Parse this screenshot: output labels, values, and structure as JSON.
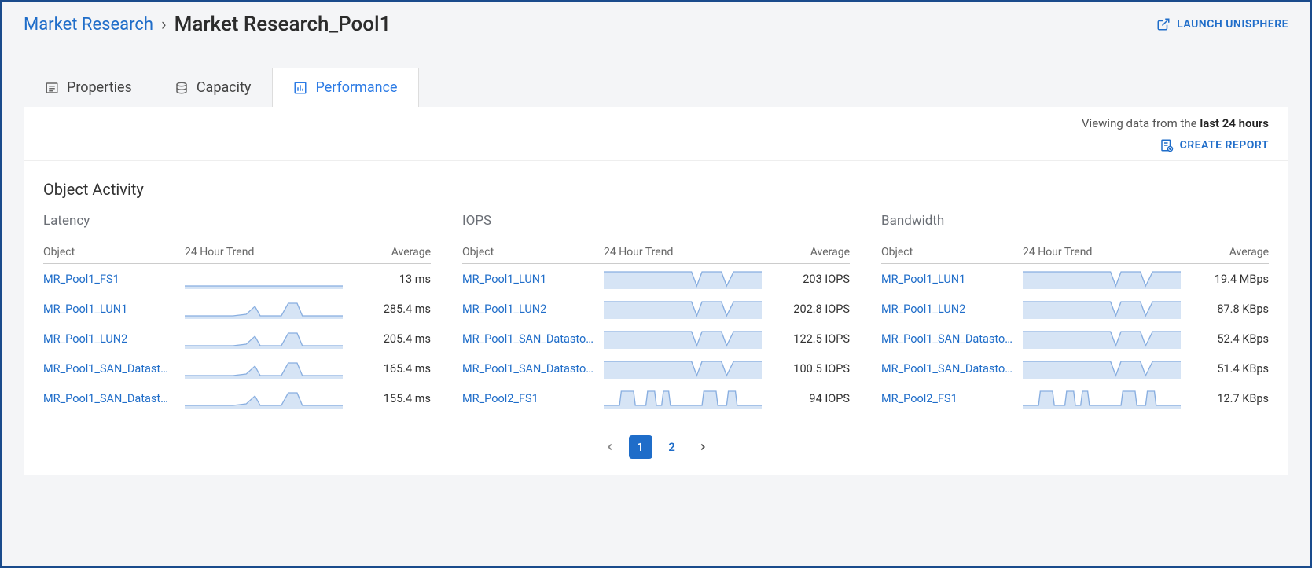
{
  "breadcrumb": {
    "parent": "Market Research",
    "title": "Market Research_Pool1"
  },
  "header": {
    "launch_label": "LAUNCH UNISPHERE"
  },
  "tabs": {
    "properties": "Properties",
    "capacity": "Capacity",
    "performance": "Performance"
  },
  "info": {
    "viewing_prefix": "Viewing data from the ",
    "viewing_range": "last 24 hours",
    "create_report": "CREATE REPORT"
  },
  "section_title": "Object Activity",
  "columns": {
    "object": "Object",
    "trend": "24 Hour Trend",
    "average": "Average"
  },
  "panels": {
    "latency": {
      "title": "Latency",
      "rows": [
        {
          "object": "MR_Pool1_FS1",
          "average": "13 ms",
          "shape": "flat"
        },
        {
          "object": "MR_Pool1_LUN1",
          "average": "285.4 ms",
          "shape": "bumps"
        },
        {
          "object": "MR_Pool1_LUN2",
          "average": "205.4 ms",
          "shape": "bumps"
        },
        {
          "object": "MR_Pool1_SAN_Datast…",
          "average": "165.4 ms",
          "shape": "bumps"
        },
        {
          "object": "MR_Pool1_SAN_Datast…",
          "average": "155.4 ms",
          "shape": "bumps"
        }
      ]
    },
    "iops": {
      "title": "IOPS",
      "rows": [
        {
          "object": "MR_Pool1_LUN1",
          "average": "203 IOPS",
          "shape": "dips"
        },
        {
          "object": "MR_Pool1_LUN2",
          "average": "202.8 IOPS",
          "shape": "dips"
        },
        {
          "object": "MR_Pool1_SAN_Datasto…",
          "average": "122.5 IOPS",
          "shape": "dips"
        },
        {
          "object": "MR_Pool1_SAN_Datasto…",
          "average": "100.5 IOPS",
          "shape": "dips"
        },
        {
          "object": "MR_Pool2_FS1",
          "average": "94 IOPS",
          "shape": "pulses"
        }
      ]
    },
    "bandwidth": {
      "title": "Bandwidth",
      "rows": [
        {
          "object": "MR_Pool1_LUN1",
          "average": "19.4 MBps",
          "shape": "dips"
        },
        {
          "object": "MR_Pool1_LUN2",
          "average": "87.8 KBps",
          "shape": "dips"
        },
        {
          "object": "MR_Pool1_SAN_Datasto…",
          "average": "52.4 KBps",
          "shape": "dips"
        },
        {
          "object": "MR_Pool1_SAN_Datasto…",
          "average": "51.4 KBps",
          "shape": "dips"
        },
        {
          "object": "MR_Pool2_FS1",
          "average": "12.7 KBps",
          "shape": "pulses"
        }
      ]
    }
  },
  "pagination": {
    "pages": [
      "1",
      "2"
    ],
    "current": "1"
  }
}
